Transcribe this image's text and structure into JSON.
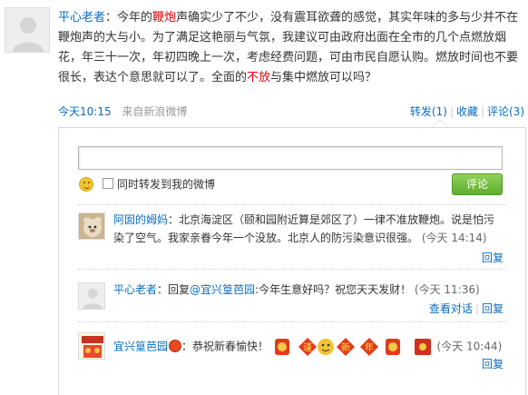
{
  "post": {
    "author": "平心老者",
    "colon": "：",
    "text_before": "今年的",
    "highlight_1": "鞭炮",
    "text_mid": "声确实少了不少，没有震耳欲聋的感觉，其实年味的多与少并不在鞭炮声的大与小。为了满足这艳丽与气氛，我建议可由政府出面在全市的几个点燃放烟花，年三十一次，年初四晚上一次，考虑经费问题，可由市民自愿认购。燃放时间也不要很长，表达个意思就可以了。全面的",
    "highlight_2": "不放",
    "text_after": "与集中燃放可以吗？",
    "time": "今天10:15",
    "source": "来自新浪微博",
    "actions": {
      "forward": "转发(1)",
      "favorite": "收藏",
      "comment": "评论(3)"
    }
  },
  "comment_form": {
    "input_value": "",
    "forward_label": "同时转发到我的微博",
    "submit_label": "评论"
  },
  "comments": [
    {
      "author": "阿囡的姆妈",
      "text": "：北京海淀区（颐和园附近算是郊区了）一律不准放鞭炮。说是怕污染了空气。我家亲眷今年一个没放。北京人的防污染意识很强。",
      "time": "(今天 14:14)",
      "reply": "回复"
    },
    {
      "author": "平心老者",
      "text": "：回复",
      "mention": "@宜兴篁芭园",
      "text2": ":今年生意好吗？祝您天天发财！",
      "time": "(今天 11:36)",
      "view_thread": "查看对话",
      "reply": "回复"
    },
    {
      "author": "宜兴篁芭园",
      "text": "：恭祝新春愉快！",
      "festive_chars": [
        "谨",
        "新",
        "年"
      ],
      "time": "(今天 10:44)",
      "reply": "回复"
    }
  ],
  "colors": {
    "link": "#0a6cbf",
    "highlight": "#e60012",
    "submit_button": "#5eae2d"
  }
}
